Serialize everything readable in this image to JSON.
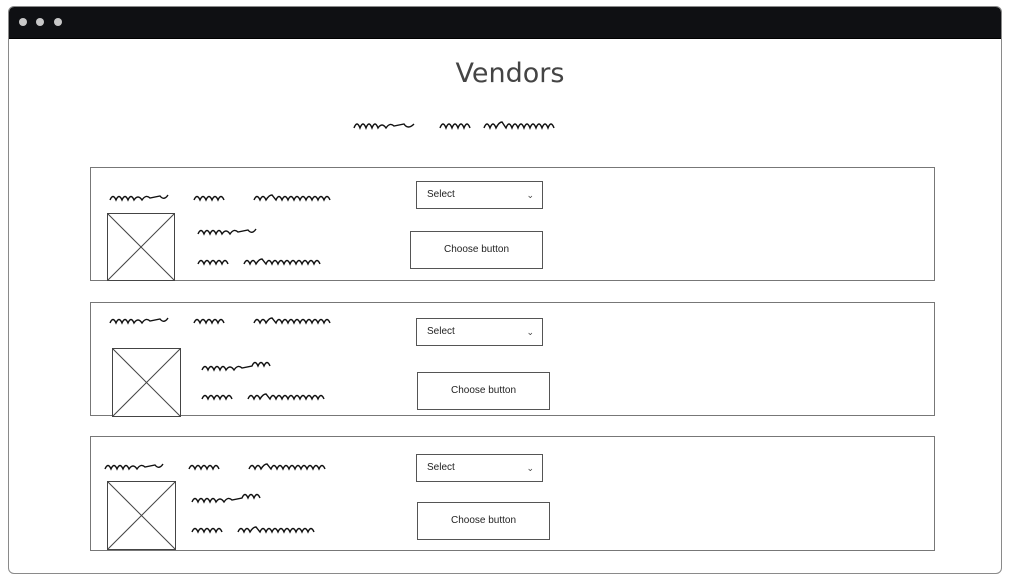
{
  "window": {
    "title_bar": ""
  },
  "page": {
    "title": "Vendors",
    "subtitle_icon": "placeholder-scribble-text"
  },
  "vendors": [
    {
      "select_label": "Select",
      "choose_label": "Choose button",
      "image_icon": "image-placeholder-icon",
      "chevron_icon": "chevron-down-icon",
      "chevron": "⌄"
    },
    {
      "select_label": "Select",
      "choose_label": "Choose button",
      "image_icon": "image-placeholder-icon",
      "chevron_icon": "chevron-down-icon",
      "chevron": "⌄"
    },
    {
      "select_label": "Select",
      "choose_label": "Choose button",
      "image_icon": "image-placeholder-icon",
      "chevron_icon": "chevron-down-icon",
      "chevron": "⌄"
    }
  ],
  "colors": {
    "title_bar": "#0f1013",
    "border": "#777777",
    "text": "#444444"
  }
}
